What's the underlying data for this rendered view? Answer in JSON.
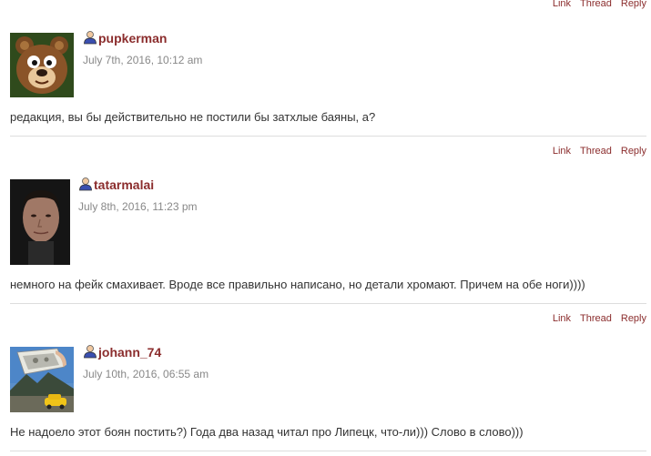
{
  "actions": {
    "link": "Link",
    "thread": "Thread",
    "reply": "Reply"
  },
  "comments": [
    {
      "username": "pupkerman",
      "date": "July 7th, 2016, 10:12 am",
      "text": "редакция, вы бы действительно не постили бы затхлые баяны, а?",
      "avatar": "bear-avatar"
    },
    {
      "username": "tatarmalai",
      "date": "July 8th, 2016, 11:23 pm",
      "text": "немного на фейк смахивает. Вроде все правильно написано, но детали хромают. Причем на обе ноги))))",
      "avatar": "man-photo-avatar"
    },
    {
      "username": "johann_74",
      "date": "July 10th, 2016, 06:55 am",
      "text": "Не надоело этот боян постить?) Года два назад читал про Липецк, что-ли))) Слово в слово)))",
      "avatar": "landscape-car-avatar"
    }
  ],
  "colors": {
    "accent": "#8b2d2d",
    "date": "#888888",
    "divider": "#dddddd"
  }
}
